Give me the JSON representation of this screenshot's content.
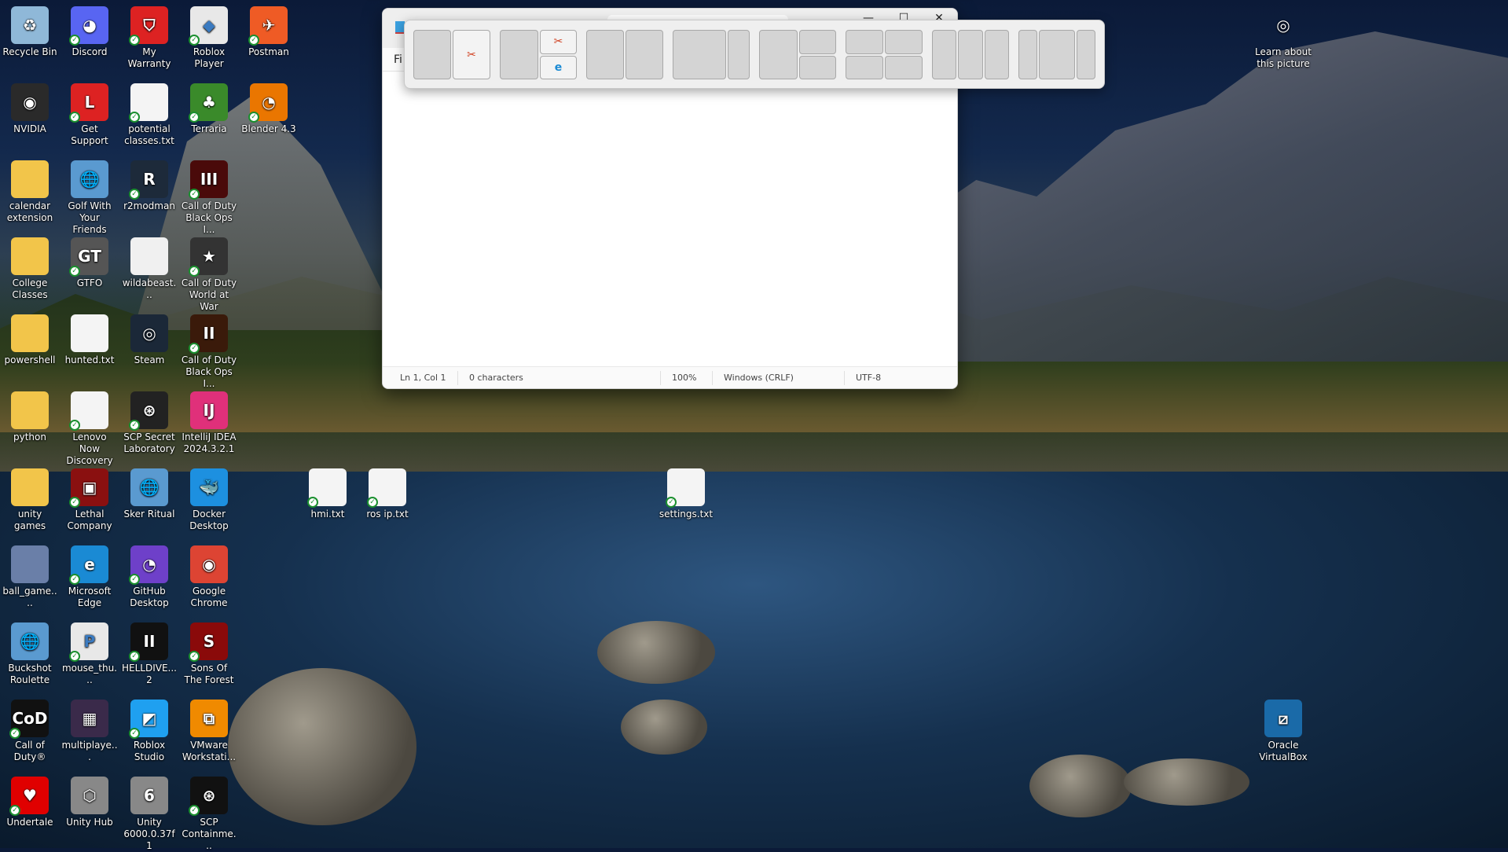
{
  "desktop": {
    "columns": [
      [
        {
          "label": "Recycle Bin",
          "icon": "recycle-bin-icon",
          "color": "#8fb8d8",
          "glyph": "♻",
          "badge": false
        },
        {
          "label": "NVIDIA",
          "icon": "nvidia-icon",
          "color": "#2a2a2a",
          "glyph": "◉",
          "badge": false
        },
        {
          "label": "calendar extension",
          "icon": "folder-icon",
          "color": "#f2c54a",
          "glyph": "",
          "badge": false
        },
        {
          "label": "College Classes",
          "icon": "folder-icon",
          "color": "#f2c54a",
          "glyph": "",
          "badge": false
        },
        {
          "label": "powershell",
          "icon": "folder-icon",
          "color": "#f2c54a",
          "glyph": "",
          "badge": false
        },
        {
          "label": "python",
          "icon": "folder-icon",
          "color": "#f2c54a",
          "glyph": "",
          "badge": false
        },
        {
          "label": "unity games",
          "icon": "folder-icon",
          "color": "#f2c54a",
          "glyph": "",
          "badge": false
        },
        {
          "label": "ball_game....",
          "icon": "image-file-icon",
          "color": "#6a7fa8",
          "glyph": "",
          "badge": false
        },
        {
          "label": "Buckshot Roulette",
          "icon": "globe-icon",
          "color": "#5a9ad0",
          "glyph": "🌐",
          "badge": false
        },
        {
          "label": "Call of Duty®",
          "icon": "call-of-duty-icon",
          "color": "#111111",
          "glyph": "CoD",
          "badge": true
        },
        {
          "label": "Undertale",
          "icon": "heart-icon",
          "color": "#e00000",
          "glyph": "♥",
          "badge": true
        }
      ],
      [
        {
          "label": "Discord",
          "icon": "discord-icon",
          "color": "#5865f2",
          "glyph": "◕",
          "badge": true
        },
        {
          "label": "Get Support",
          "icon": "lenovo-support-icon",
          "color": "#d22",
          "glyph": "L",
          "badge": true
        },
        {
          "label": "Golf With Your Friends",
          "icon": "globe-icon",
          "color": "#5a9ad0",
          "glyph": "🌐",
          "badge": false
        },
        {
          "label": "GTFO",
          "icon": "gtfo-icon",
          "color": "#555",
          "glyph": "GT",
          "badge": true
        },
        {
          "label": "hunted.txt",
          "icon": "text-file-icon",
          "color": "#f4f4f4",
          "glyph": "",
          "badge": false
        },
        {
          "label": "Lenovo Now Discovery",
          "icon": "file-icon",
          "color": "#f4f4f4",
          "glyph": "",
          "badge": true
        },
        {
          "label": "Lethal Company",
          "icon": "lethal-company-icon",
          "color": "#8a1010",
          "glyph": "▣",
          "badge": true
        },
        {
          "label": "Microsoft Edge",
          "icon": "edge-icon",
          "color": "#1a8ad4",
          "glyph": "e",
          "badge": true
        },
        {
          "label": "mouse_thu...",
          "icon": "powerpoint-thumbnail-icon",
          "color": "#e8e8e8",
          "glyph": "P",
          "badge": true
        },
        {
          "label": "multiplaye...",
          "icon": "image-file-icon",
          "color": "#3a2a4a",
          "glyph": "▦",
          "badge": false
        },
        {
          "label": "Unity Hub",
          "icon": "unity-hub-icon",
          "color": "#888",
          "glyph": "⬡",
          "badge": false
        }
      ],
      [
        {
          "label": "My Warranty",
          "icon": "warranty-icon",
          "color": "#d22",
          "glyph": "⛉",
          "badge": true
        },
        {
          "label": "potential classes.txt",
          "icon": "text-file-icon",
          "color": "#f4f4f4",
          "glyph": "",
          "badge": true
        },
        {
          "label": "r2modman",
          "icon": "r2modman-icon",
          "color": "#1d2a3a",
          "glyph": "R",
          "badge": true
        },
        {
          "label": "wildabeast...",
          "icon": "image-file-icon",
          "color": "#f0f0f0",
          "glyph": "",
          "badge": false
        },
        {
          "label": "Steam",
          "icon": "steam-icon",
          "color": "#1b2838",
          "glyph": "◎",
          "badge": false
        },
        {
          "label": "SCP Secret Laboratory",
          "icon": "scp-sl-icon",
          "color": "#222",
          "glyph": "⊛",
          "badge": true
        },
        {
          "label": "Sker Ritual",
          "icon": "globe-icon",
          "color": "#5a9ad0",
          "glyph": "🌐",
          "badge": false
        },
        {
          "label": "GitHub Desktop",
          "icon": "github-desktop-icon",
          "color": "#6e40c9",
          "glyph": "◔",
          "badge": true
        },
        {
          "label": "HELLDIVE... 2",
          "icon": "helldivers-icon",
          "color": "#111",
          "glyph": "II",
          "badge": true
        },
        {
          "label": "Roblox Studio",
          "icon": "roblox-studio-icon",
          "color": "#1fa0f0",
          "glyph": "◩",
          "badge": true
        },
        {
          "label": "Unity 6000.0.37f1",
          "icon": "unity-icon",
          "color": "#888",
          "glyph": "6",
          "badge": false
        }
      ],
      [
        {
          "label": "Roblox Player",
          "icon": "roblox-icon",
          "color": "#e8e8e8",
          "glyph": "◆",
          "badge": true
        },
        {
          "label": "Terraria",
          "icon": "terraria-icon",
          "color": "#3a8a2a",
          "glyph": "♣",
          "badge": true
        },
        {
          "label": "Call of Duty Black Ops I...",
          "icon": "call-of-duty-icon",
          "color": "#4a0a0a",
          "glyph": "III",
          "badge": true
        },
        {
          "label": "Call of Duty World at War",
          "icon": "call-of-duty-icon",
          "color": "#333",
          "glyph": "★",
          "badge": true
        },
        {
          "label": "Call of Duty Black Ops I...",
          "icon": "call-of-duty-icon",
          "color": "#3a1a0a",
          "glyph": "II",
          "badge": true
        },
        {
          "label": "IntelliJ IDEA 2024.3.2.1",
          "icon": "intellij-icon",
          "color": "#e0307a",
          "glyph": "IJ",
          "badge": false
        },
        {
          "label": "Docker Desktop",
          "icon": "docker-icon",
          "color": "#1d90e0",
          "glyph": "🐳",
          "badge": false
        },
        {
          "label": "Google Chrome",
          "icon": "chrome-icon",
          "color": "#dd4433",
          "glyph": "◉",
          "badge": false
        },
        {
          "label": "Sons Of The Forest",
          "icon": "sons-of-the-forest-icon",
          "color": "#8a0a0a",
          "glyph": "S",
          "badge": true
        },
        {
          "label": "VMware Workstati...",
          "icon": "vmware-icon",
          "color": "#f08a00",
          "glyph": "⧉",
          "badge": false
        },
        {
          "label": "SCP Containme...",
          "icon": "scp-icon",
          "color": "#111",
          "glyph": "⊛",
          "badge": true
        }
      ],
      [
        {
          "label": "Postman",
          "icon": "postman-icon",
          "color": "#ef5b25",
          "glyph": "✈",
          "badge": true
        },
        {
          "label": "Blender 4.3",
          "icon": "blender-icon",
          "color": "#ea7600",
          "glyph": "◔",
          "badge": true
        }
      ]
    ],
    "loose": [
      {
        "label": "hmi.txt",
        "icon": "text-file-icon",
        "color": "#f4f4f4",
        "glyph": "",
        "badge": true
      },
      {
        "label": "ros ip.txt",
        "icon": "text-file-icon",
        "color": "#f4f4f4",
        "glyph": "",
        "badge": true
      },
      {
        "label": "settings.txt",
        "icon": "text-file-icon",
        "color": "#f4f4f4",
        "glyph": "",
        "badge": true
      },
      {
        "label": "Learn about this picture",
        "icon": "camera-icon",
        "color": "transparent",
        "glyph": "◎",
        "badge": false
      },
      {
        "label": "Oracle VirtualBox",
        "icon": "virtualbox-icon",
        "color": "#1a6aa8",
        "glyph": "⧄",
        "badge": false
      }
    ]
  },
  "notepad": {
    "menu_file": "Fi",
    "controls": {
      "minimize": "—",
      "maximize": "☐",
      "close": "✕"
    },
    "status": {
      "position": "Ln 1, Col 1",
      "characters": "0 characters",
      "zoom": "100%",
      "line_ending": "Windows (CRLF)",
      "encoding": "UTF-8"
    }
  },
  "snap_layouts": {
    "apps": {
      "snip": "✂",
      "edge": "e"
    }
  }
}
